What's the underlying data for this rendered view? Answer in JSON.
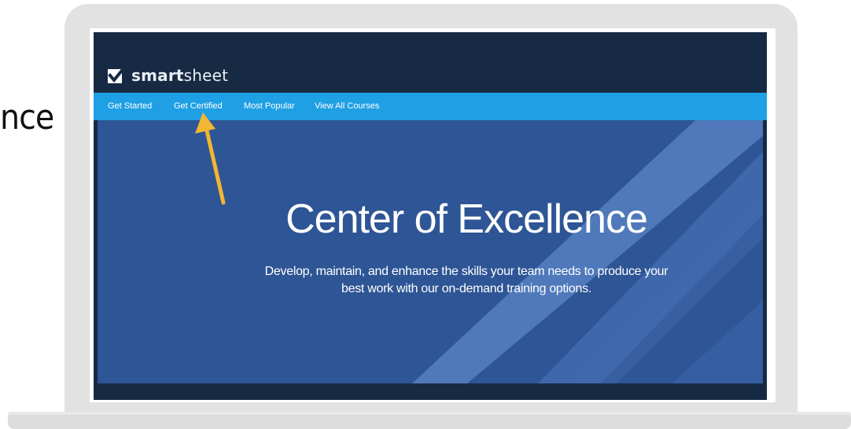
{
  "side_fragment": {
    "text": "nce"
  },
  "app": {
    "logo_text_bold": "smart",
    "logo_text_light": "sheet",
    "logo_icon": "smartsheet-check-icon"
  },
  "nav": {
    "items": [
      {
        "label": "Get Started"
      },
      {
        "label": "Get Certified"
      },
      {
        "label": "Most Popular"
      },
      {
        "label": "View All Courses"
      }
    ]
  },
  "hero": {
    "title": "Center of Excellence",
    "subtitle_line1": "Develop, maintain, and enhance the skills your team needs to produce your",
    "subtitle_line2": "best work with our on-demand training options."
  },
  "annotation": {
    "icon": "arrow-icon",
    "color": "#f2b632",
    "points_to": "Get Certified"
  },
  "colors": {
    "page_background": "#ffffff",
    "laptop_body": "#e2e2e2",
    "topbar": "#172a44",
    "navbar": "#1f9fe4",
    "hero_background": "#2e5595",
    "hero_stripe": "#5b86c8",
    "text_light": "#ffffff"
  }
}
